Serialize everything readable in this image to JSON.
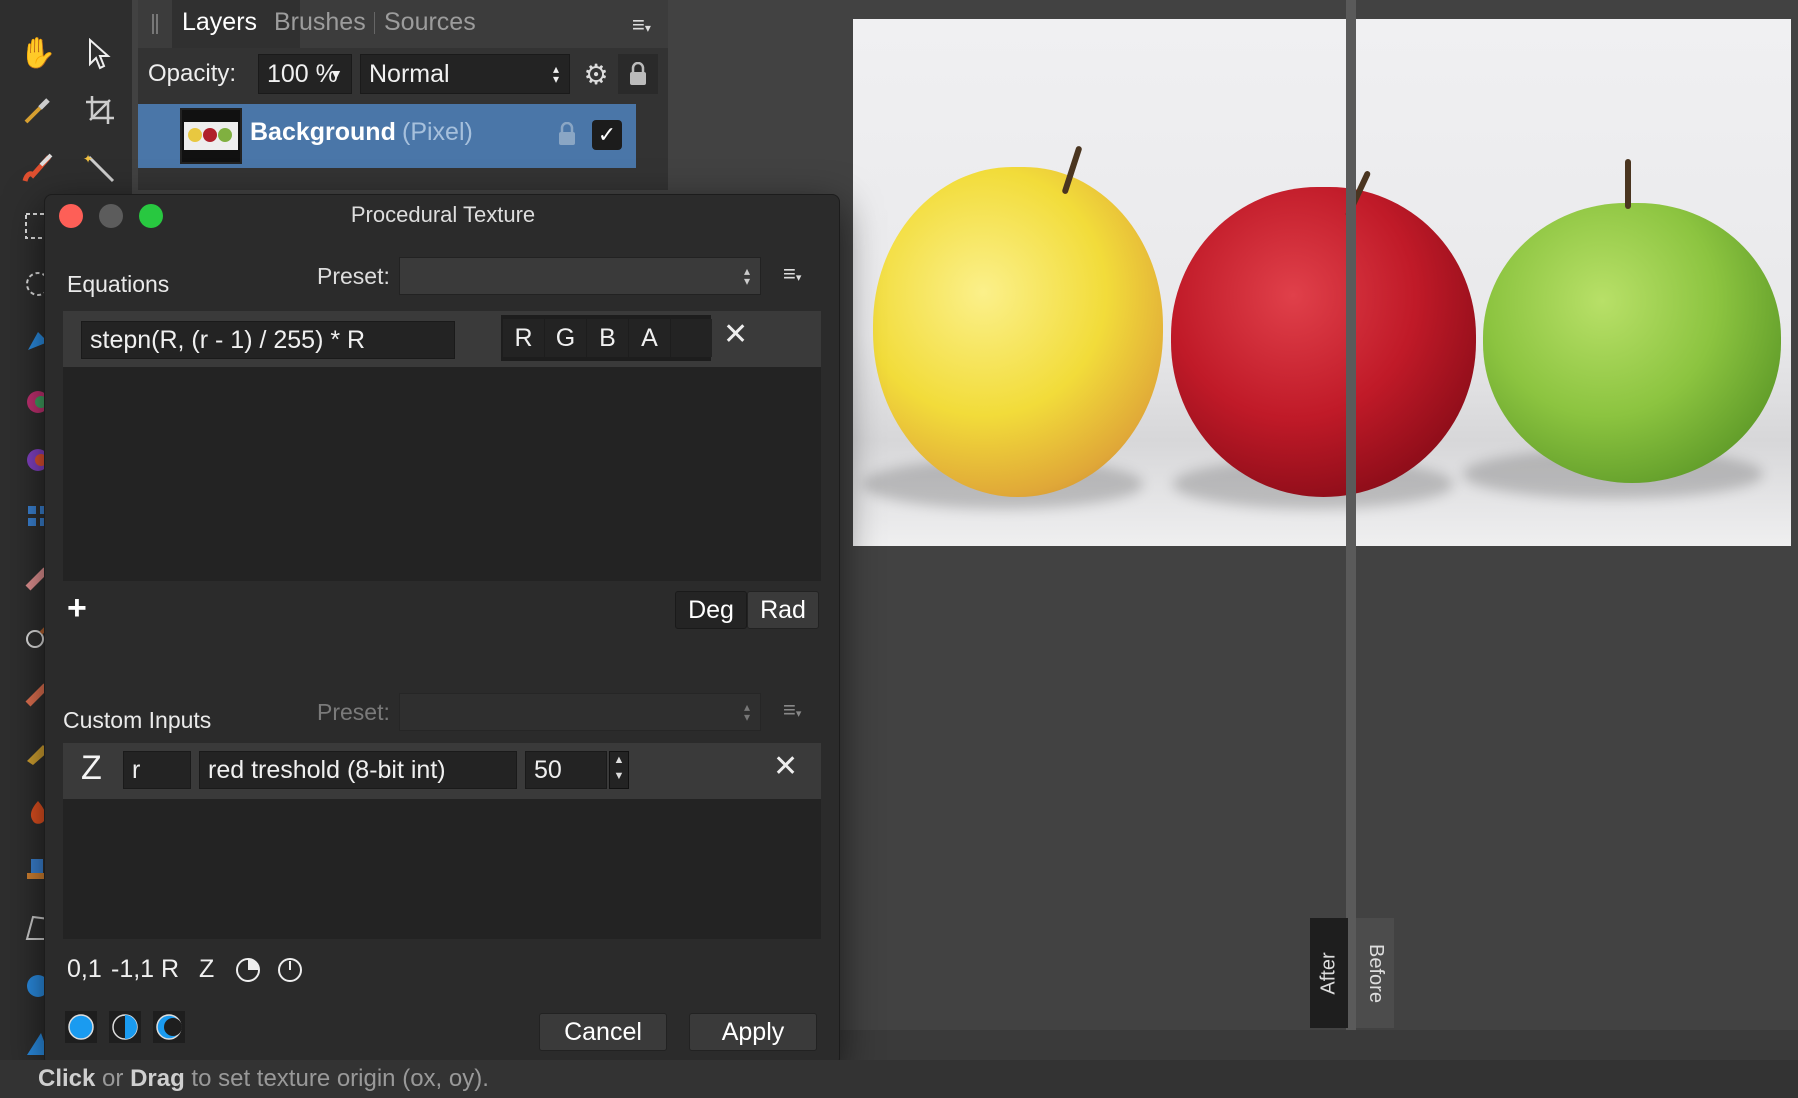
{
  "panel": {
    "tabs": [
      "Layers",
      "Brushes",
      "Sources"
    ],
    "opacity_label": "Opacity:",
    "opacity_value": "100 %",
    "blend_mode": "Normal",
    "layer": {
      "name": "Background",
      "type": "(Pixel)"
    }
  },
  "dialog": {
    "title": "Procedural Texture",
    "equations_label": "Equations",
    "preset_label": "Preset:",
    "equation_value": "stepn(R, (r - 1) / 255) * R",
    "channels": [
      "R",
      "G",
      "B",
      "A"
    ],
    "angle_modes": [
      "Deg",
      "Rad"
    ],
    "custom_inputs_label": "Custom Inputs",
    "custom_preset_label": "Preset:",
    "input": {
      "type_symbol": "Z",
      "variable": "r",
      "description": "red treshold (8-bit int)",
      "value": "50"
    },
    "coord_options": [
      "0,1",
      "-1,1",
      "R",
      "Z"
    ],
    "cancel_label": "Cancel",
    "apply_label": "Apply"
  },
  "compare": {
    "after_label": "After",
    "before_label": "Before"
  },
  "status": {
    "click": "Click",
    "or": "or",
    "drag": "Drag",
    "rest": "to set texture origin (ox, oy)."
  },
  "icons": {
    "toolbar": [
      "hand-icon",
      "pointer-icon",
      "color-picker-icon",
      "crop-icon",
      "paint-brush-icon",
      "magic-wand-icon",
      "marquee-select-icon",
      "lasso-icon",
      "flood-fill-icon",
      "gradient-icon",
      "fill-icon",
      "grid-icon",
      "eraser-icon",
      "dodge-icon",
      "burn-icon",
      "smudge-icon",
      "stamp-icon",
      "mesh-warp-icon",
      "sphere-icon",
      "triangle-icon"
    ]
  },
  "colors": {
    "selection": "#4a76a8",
    "close": "#fe5f57",
    "minimize": "#5c5c5c",
    "zoom": "#28c840",
    "accent_blue": "#1a9bf0"
  }
}
